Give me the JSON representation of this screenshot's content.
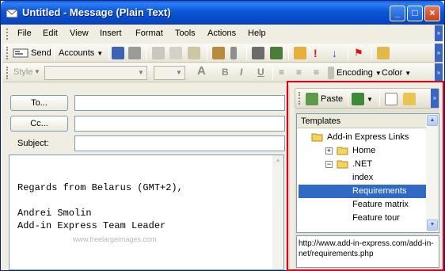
{
  "window": {
    "title": "Untitled - Message (Plain Text)",
    "buttons": {
      "minimize": "_",
      "maximize": "□",
      "close": "×"
    }
  },
  "menu": {
    "items": [
      {
        "label": "File",
        "key": "F"
      },
      {
        "label": "Edit",
        "key": "E"
      },
      {
        "label": "View",
        "key": "V"
      },
      {
        "label": "Insert",
        "key": "I"
      },
      {
        "label": "Format",
        "key": "o"
      },
      {
        "label": "Tools",
        "key": "T"
      },
      {
        "label": "Actions",
        "key": "A"
      },
      {
        "label": "Help",
        "key": "H"
      }
    ]
  },
  "toolbar": {
    "send_label": "Send",
    "accounts_label": "Accounts",
    "style_label": "Style",
    "encoding_label": "Encoding",
    "color_label": "Color"
  },
  "header": {
    "to_label": "To...",
    "cc_label": "Cc...",
    "subject_label": "Subject:",
    "to_value": "",
    "cc_value": "",
    "subject_value": ""
  },
  "body": {
    "lines": [
      "Regards from Belarus (GMT+2),",
      "Andrei Smolin",
      "Add-in Express Team Leader"
    ],
    "watermark": "www.freelargeimages.com"
  },
  "pane": {
    "paste_label": "Paste",
    "tree_header": "Templates",
    "tree": [
      {
        "label": "Add-in Express Links",
        "expander": "−",
        "folder": true
      },
      {
        "label": "Home",
        "expander": "+",
        "folder": true
      },
      {
        "label": ".NET",
        "expander": "−",
        "folder": true
      },
      {
        "label": "index",
        "expander": "",
        "folder": false
      },
      {
        "label": "Requirements",
        "expander": "",
        "folder": false,
        "selected": true
      },
      {
        "label": "Feature matrix",
        "expander": "",
        "folder": false
      },
      {
        "label": "Feature tour",
        "expander": "",
        "folder": false
      }
    ],
    "url": "http://www.add-in-express.com/add-in-net/requirements.php"
  },
  "colors": {
    "titlebar": "#0b57d8",
    "highlight_border": "#e0001b",
    "selection": "#316ac5",
    "face": "#f0eee3"
  }
}
